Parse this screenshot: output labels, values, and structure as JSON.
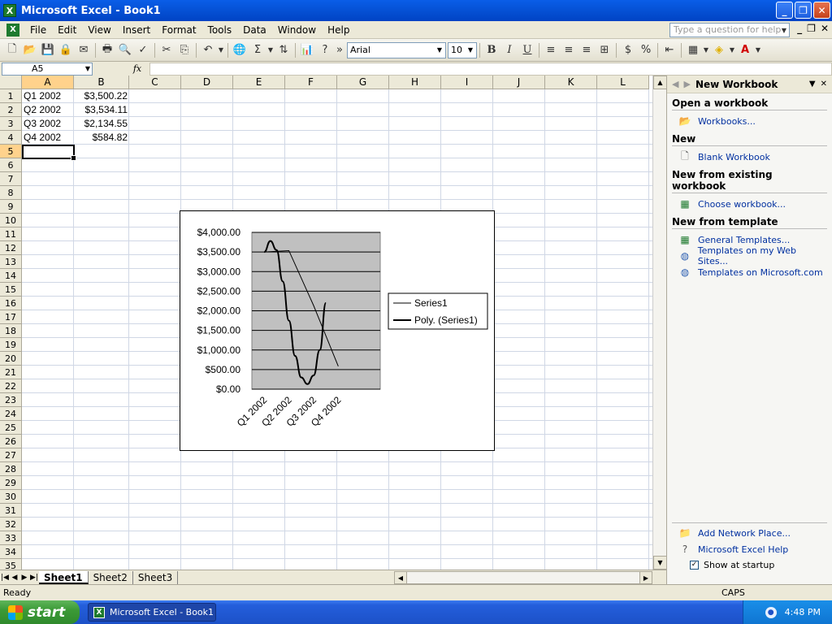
{
  "window": {
    "title": "Microsoft Excel - Book1"
  },
  "menu": {
    "items": [
      "File",
      "Edit",
      "View",
      "Insert",
      "Format",
      "Tools",
      "Data",
      "Window",
      "Help"
    ],
    "help_placeholder": "Type a question for help"
  },
  "toolbar": {
    "font_name": "Arial",
    "font_size": "10",
    "bold": "B",
    "italic": "I",
    "underline": "U",
    "currency": "$",
    "percent": "%"
  },
  "formula_bar": {
    "name_box": "A5",
    "fx": "fx",
    "value": ""
  },
  "grid": {
    "columns": [
      "A",
      "B",
      "C",
      "D",
      "E",
      "F",
      "G",
      "H",
      "I",
      "J",
      "K",
      "L"
    ],
    "rows": [
      "1",
      "2",
      "3",
      "4",
      "5",
      "6",
      "7",
      "8",
      "9",
      "10",
      "11",
      "12",
      "13",
      "14",
      "15",
      "16",
      "17",
      "18",
      "19",
      "20",
      "21",
      "22",
      "23",
      "24",
      "25",
      "26",
      "27",
      "28",
      "29",
      "30",
      "31",
      "32",
      "33",
      "34",
      "35"
    ],
    "active_column": "A",
    "active_row": "5",
    "cells": [
      {
        "a": "Q1 2002",
        "b": "$3,500.22"
      },
      {
        "a": "Q2 2002",
        "b": "$3,534.11"
      },
      {
        "a": "Q3 2002",
        "b": "$2,134.55"
      },
      {
        "a": "Q4 2002",
        "b": "$584.82"
      }
    ]
  },
  "chart_data": {
    "type": "line",
    "categories": [
      "Q1 2002",
      "Q2 2002",
      "Q3 2002",
      "Q4 2002"
    ],
    "series": [
      {
        "name": "Series1",
        "values": [
          3500.22,
          3534.11,
          2134.55,
          584.82
        ]
      },
      {
        "name": "Poly. (Series1)",
        "trendline": "polynomial",
        "x": [
          0,
          0.5,
          1,
          1.5,
          2,
          2.5,
          3,
          3.5,
          4,
          4.5,
          5
        ],
        "values": [
          3500,
          3780,
          3550,
          2750,
          1750,
          850,
          300,
          130,
          350,
          1000,
          2200
        ]
      }
    ],
    "ylim": [
      0,
      4000
    ],
    "yticks": [
      "$4,000.00",
      "$3,500.00",
      "$3,000.00",
      "$2,500.00",
      "$2,000.00",
      "$1,500.00",
      "$1,000.00",
      "$500.00",
      "$0.00"
    ],
    "plot_area_color": "#c0c0c0",
    "grid": true,
    "legend": "right"
  },
  "sheets": {
    "tabs": [
      "Sheet1",
      "Sheet2",
      "Sheet3"
    ],
    "active": "Sheet1"
  },
  "status": {
    "text": "Ready",
    "caps": "CAPS"
  },
  "taskpane": {
    "title": "New Workbook",
    "sections": [
      {
        "title": "Open a workbook",
        "links": [
          {
            "label": "Workbooks...",
            "icon": "folder-icon"
          }
        ]
      },
      {
        "title": "New",
        "links": [
          {
            "label": "Blank Workbook",
            "icon": "blank-doc-icon"
          }
        ]
      },
      {
        "title": "New from existing workbook",
        "links": [
          {
            "label": "Choose workbook...",
            "icon": "excel-file-icon"
          }
        ]
      },
      {
        "title": "New from template",
        "links": [
          {
            "label": "General Templates...",
            "icon": "excel-file-icon"
          },
          {
            "label": "Templates on my Web Sites...",
            "icon": "globe-icon"
          },
          {
            "label": "Templates on Microsoft.com",
            "icon": "globe-icon"
          }
        ]
      }
    ],
    "bottom_links": [
      {
        "label": "Add Network Place...",
        "icon": "network-folder-icon"
      },
      {
        "label": "Microsoft Excel Help",
        "icon": "help-icon"
      }
    ],
    "show_at_startup": "Show at startup"
  },
  "taskbar": {
    "start_label": "start",
    "window_label": "Microsoft Excel - Book1",
    "clock": "4:48 PM"
  }
}
